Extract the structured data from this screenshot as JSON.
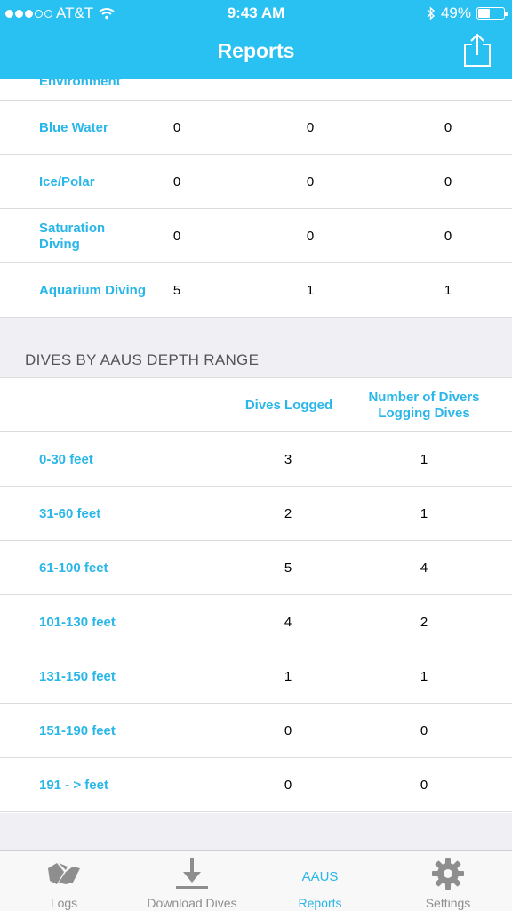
{
  "status_bar": {
    "carrier": "AT&T",
    "time": "9:43 AM",
    "battery": "49%",
    "battery_level": 0.49
  },
  "header": {
    "title": "Reports"
  },
  "env_section": {
    "partial_label": "Environment",
    "rows": [
      {
        "label": "Blue Water",
        "v1": "0",
        "v2": "0",
        "v3": "0"
      },
      {
        "label": "Ice/Polar",
        "v1": "0",
        "v2": "0",
        "v3": "0"
      },
      {
        "label": "Saturation Diving",
        "v1": "0",
        "v2": "0",
        "v3": "0"
      },
      {
        "label": "Aquarium Diving",
        "v1": "5",
        "v2": "1",
        "v3": "1"
      }
    ]
  },
  "depth_section": {
    "title": "DIVES BY AAUS DEPTH RANGE",
    "col1": "Dives Logged",
    "col2": "Number of Divers Logging Dives",
    "rows": [
      {
        "label": "0-30 feet",
        "dives": "3",
        "divers": "1"
      },
      {
        "label": "31-60 feet",
        "dives": "2",
        "divers": "1"
      },
      {
        "label": "61-100 feet",
        "dives": "5",
        "divers": "4"
      },
      {
        "label": "101-130 feet",
        "dives": "4",
        "divers": "2"
      },
      {
        "label": "131-150 feet",
        "dives": "1",
        "divers": "1"
      },
      {
        "label": "151-190 feet",
        "dives": "0",
        "divers": "0"
      },
      {
        "label": "191 - > feet",
        "dives": "0",
        "divers": "0"
      }
    ]
  },
  "tabbar": {
    "tabs": [
      {
        "label": "Logs",
        "icon": "map-icon"
      },
      {
        "label": "Download Dives",
        "icon": "download-icon"
      },
      {
        "label": "Reports",
        "icon_text": "AAUS",
        "active": true
      },
      {
        "label": "Settings",
        "icon": "gear-icon"
      }
    ]
  },
  "colors": {
    "accent": "#29c0f2",
    "link": "#29b6e8",
    "band": "#efeff4"
  }
}
